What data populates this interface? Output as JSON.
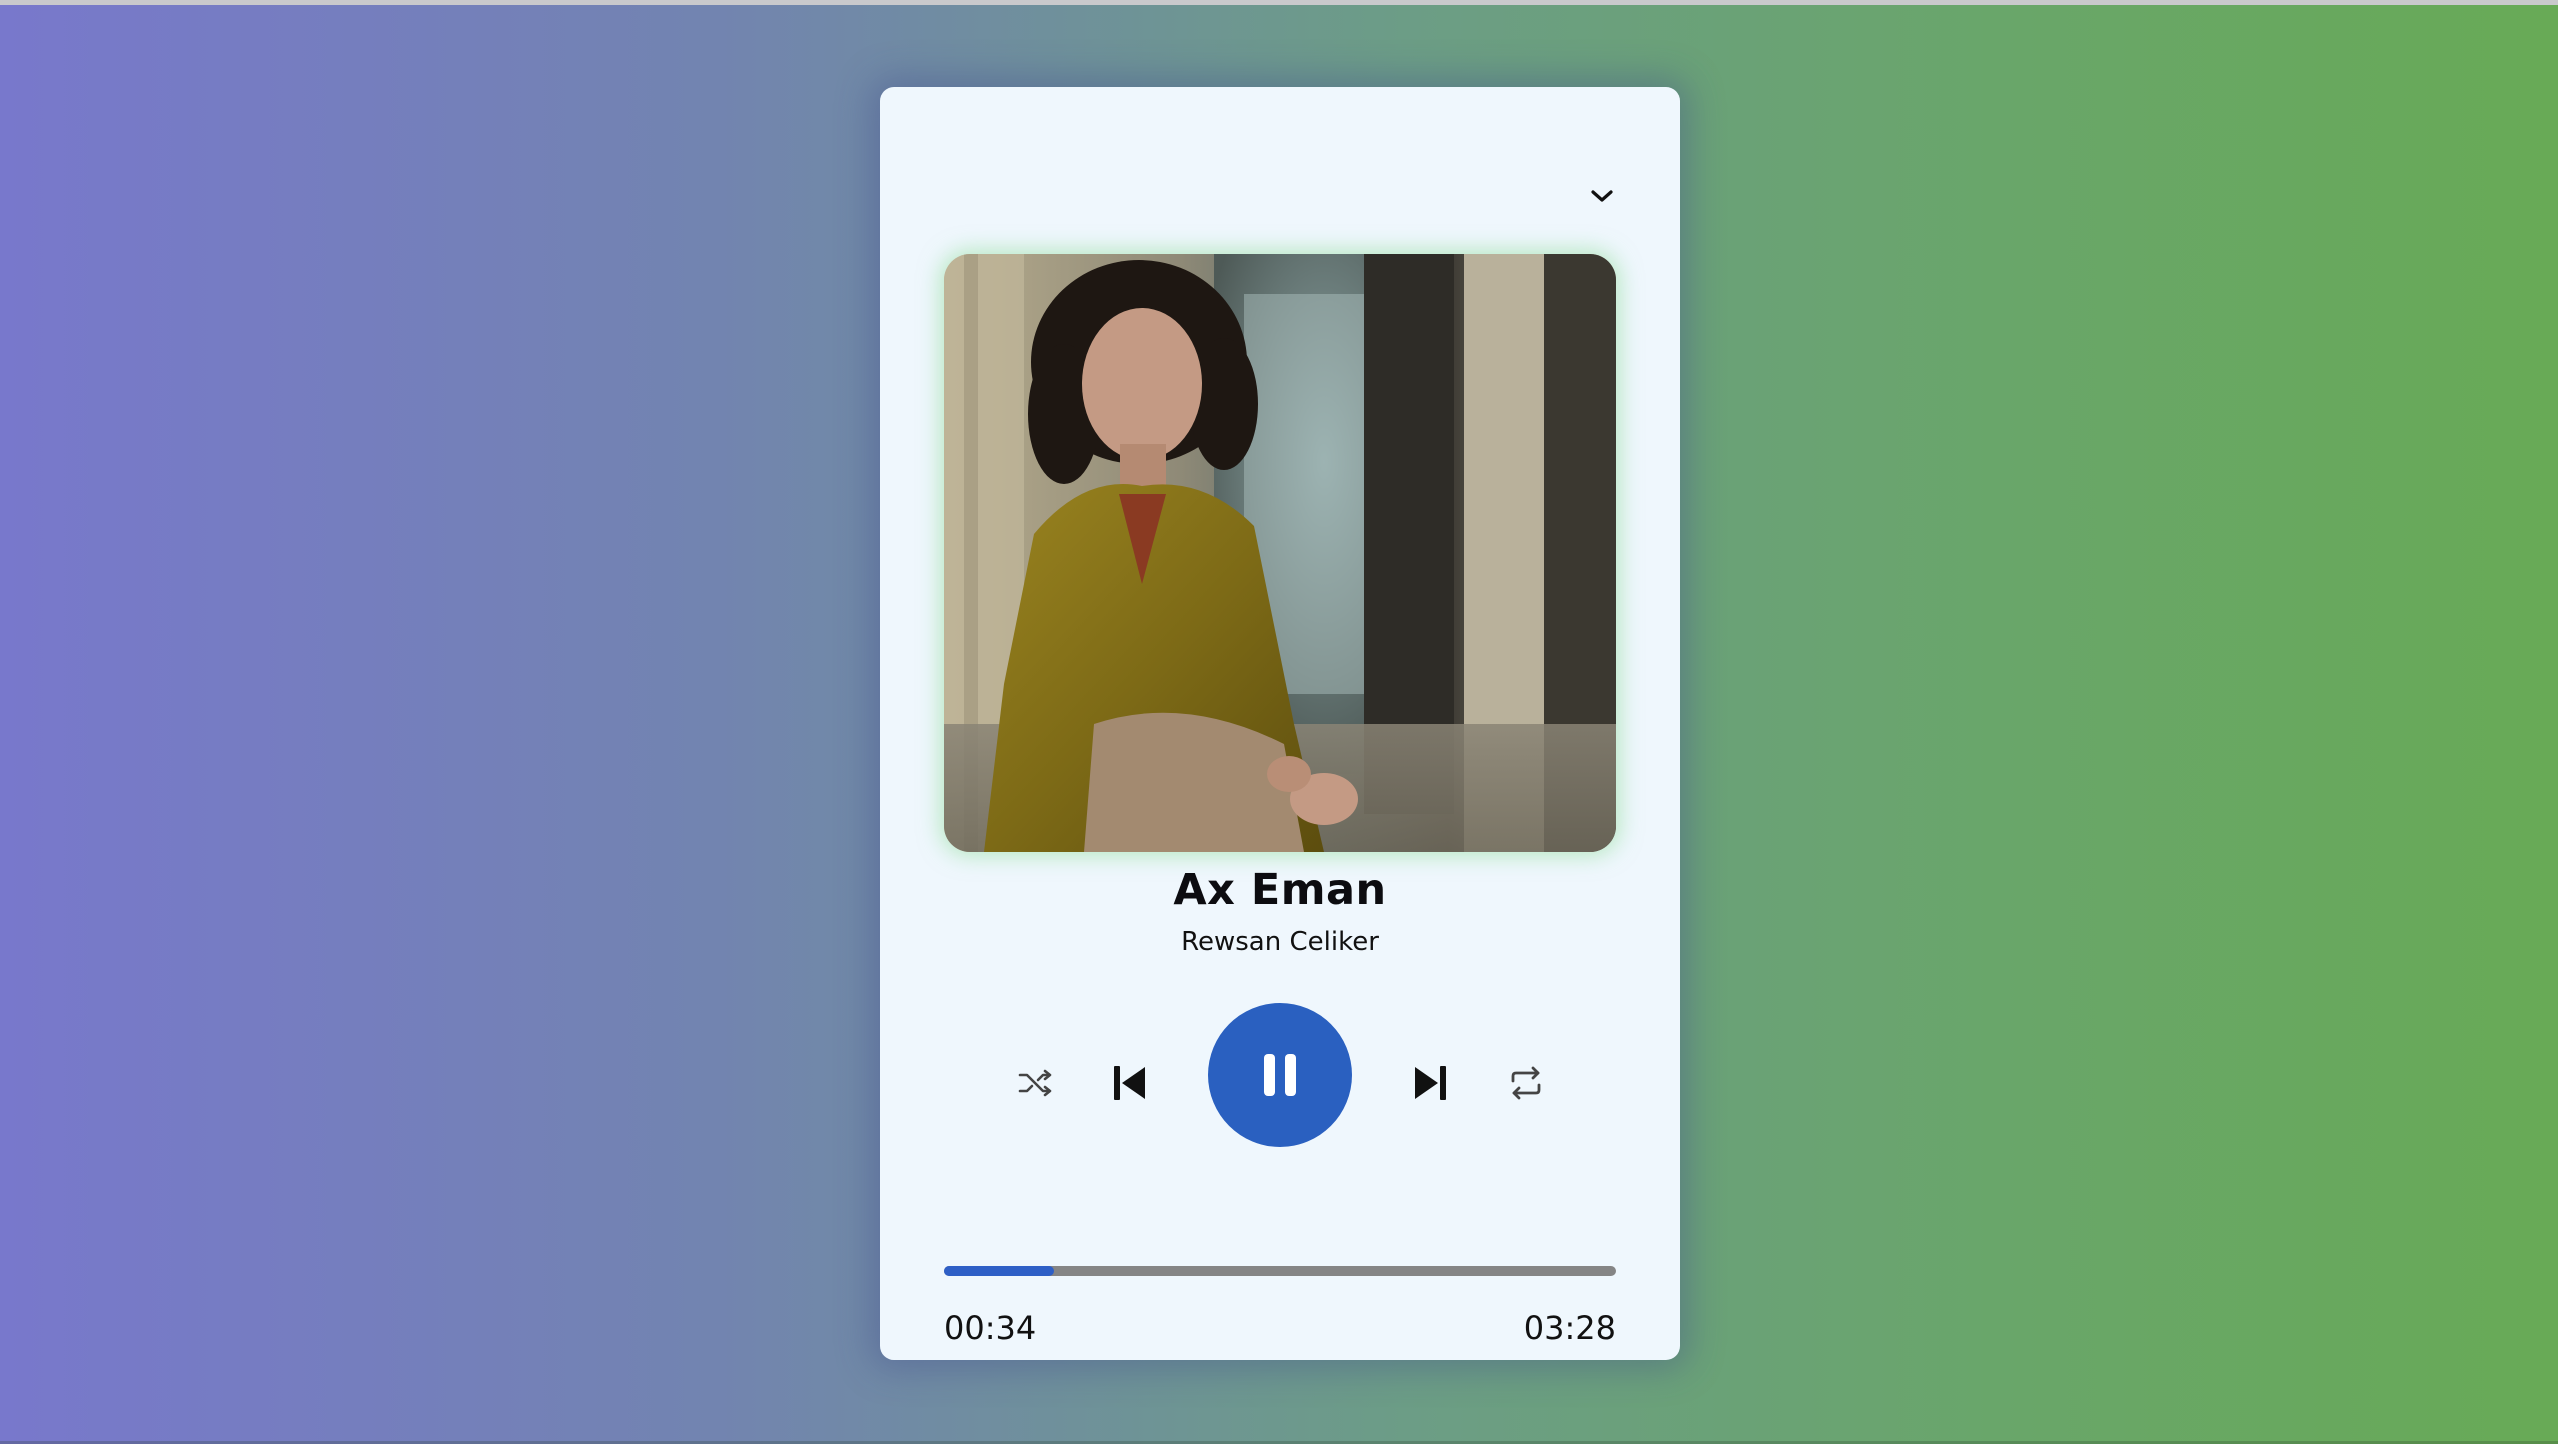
{
  "player": {
    "song_title": "Ax Eman",
    "artist": "Rewsan Celiker",
    "cover_alt": "Album cover photo",
    "current_time": "00:34",
    "total_time": "03:28",
    "progress_fraction": 0.163,
    "state": "playing"
  },
  "icons": {
    "dropdown": "chevron-down-icon",
    "shuffle": "shuffle-icon",
    "previous": "skip-previous-icon",
    "play_pause": "pause-icon",
    "next": "skip-next-icon",
    "repeat": "repeat-icon"
  },
  "colors": {
    "accent": "#2a60c0",
    "progress_track": "#858585",
    "card_background": "#eff7fd",
    "background_left": "#7878cc",
    "background_right": "#68aa56"
  }
}
